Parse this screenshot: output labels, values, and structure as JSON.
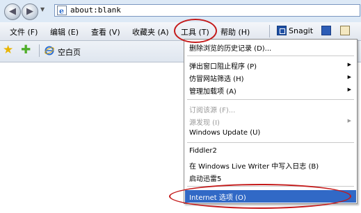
{
  "address_bar": {
    "url": "about:blank",
    "back_glyph": "◀",
    "forward_glyph": "▶",
    "dropdown_glyph": "▼"
  },
  "menu_bar": {
    "items": [
      {
        "label": "文件 (F)"
      },
      {
        "label": "编辑 (E)"
      },
      {
        "label": "查看 (V)"
      },
      {
        "label": "收藏夹 (A)"
      },
      {
        "label": "工具 (T)"
      },
      {
        "label": "帮助 (H)"
      }
    ],
    "snagit_label": "Snagit"
  },
  "favorites_bar": {
    "star_glyph": "★",
    "add_glyph": "✚",
    "tab_label": "空白页"
  },
  "tools_menu": {
    "items": [
      {
        "label": "删除浏览的历史记录 (D)..."
      },
      {
        "label": "弹出窗口阻止程序 (P)"
      },
      {
        "label": "仿冒网站筛选 (H)"
      },
      {
        "label": "管理加载项 (A)"
      },
      {
        "label": "订阅该源 (F)..."
      },
      {
        "label": "源发现 (I)"
      },
      {
        "label": "Windows Update (U)"
      },
      {
        "label": "Fiddler2"
      },
      {
        "label": "在 Windows Live Writer 中写入日志 (B)"
      },
      {
        "label": "启动迅雷5"
      },
      {
        "label": "Internet 选项 (O)"
      }
    ],
    "submenu_arrow": "▶"
  },
  "colors": {
    "highlight": "#3169c6",
    "annotation": "#c41a1a"
  }
}
